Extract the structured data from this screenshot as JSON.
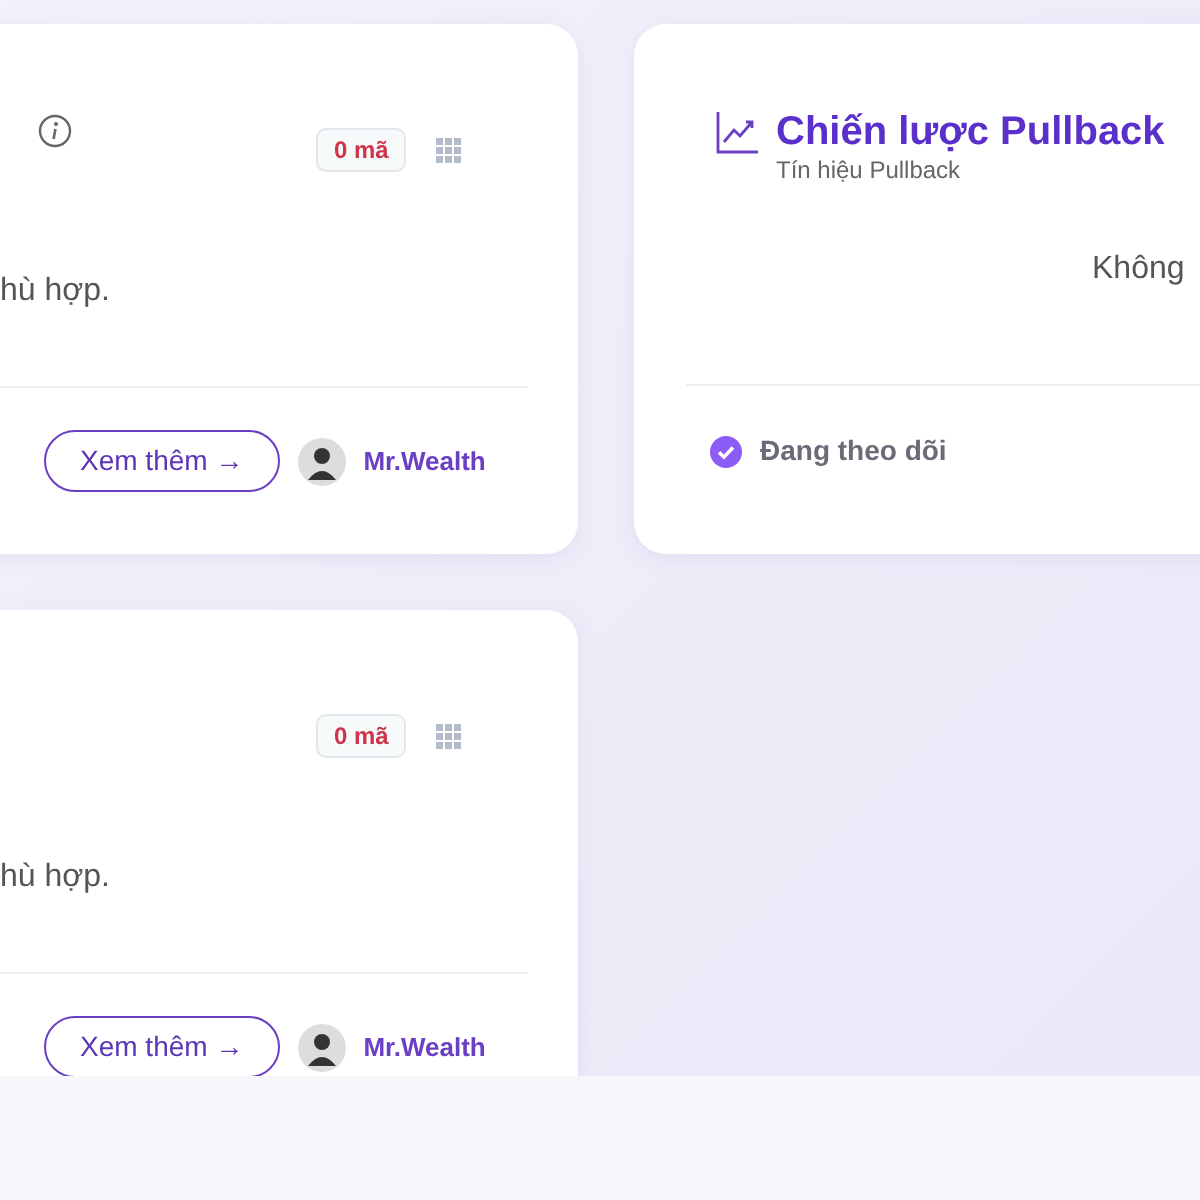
{
  "cards": [
    {
      "badge": "0 mã",
      "info": true,
      "description": "hù hợp.",
      "button": "Xem thêm →",
      "author": "Mr.Wealth"
    },
    {
      "badge": "0 mã",
      "info": false,
      "description": "hù hợp.",
      "button": "Xem thêm →",
      "author": "Mr.Wealth"
    }
  ],
  "strategy_card": {
    "title": "Chiến lược Pullback",
    "subtitle": "Tín hiệu Pullback",
    "description": "Không",
    "status": "Đang theo dõi",
    "following": true
  }
}
